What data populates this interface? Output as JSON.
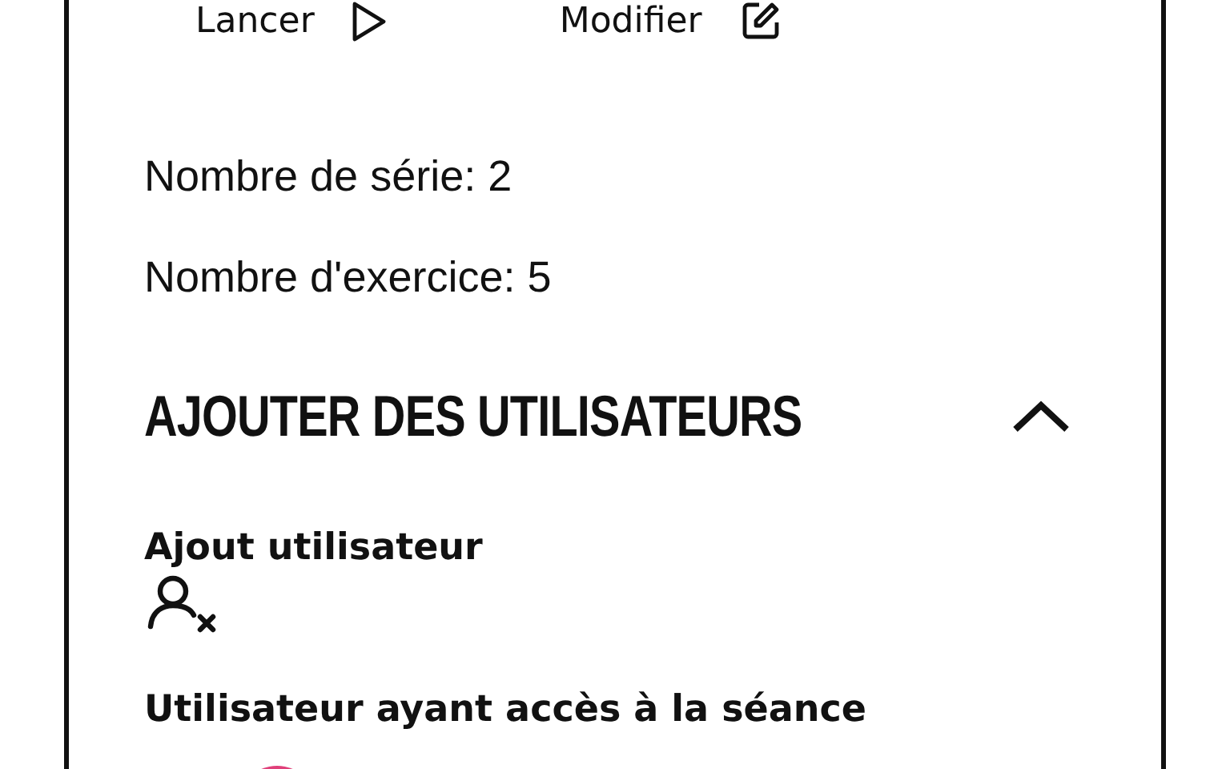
{
  "actions": [
    {
      "kind": "play",
      "label": "Lancer"
    },
    {
      "kind": "edit",
      "label": "Modifier"
    }
  ],
  "stats": [
    "Nombre de série: 2",
    "Nombre d'exercice: 5"
  ],
  "section": {
    "title": "AJOUTER DES UTILISATEURS",
    "expanded": true
  },
  "add_user": {
    "label": "Ajout utilisateur"
  },
  "access": {
    "label": "Utilisateur ayant accès à la séance",
    "users": [
      {
        "kind": "avatar",
        "color": "#e0407a"
      }
    ]
  }
}
